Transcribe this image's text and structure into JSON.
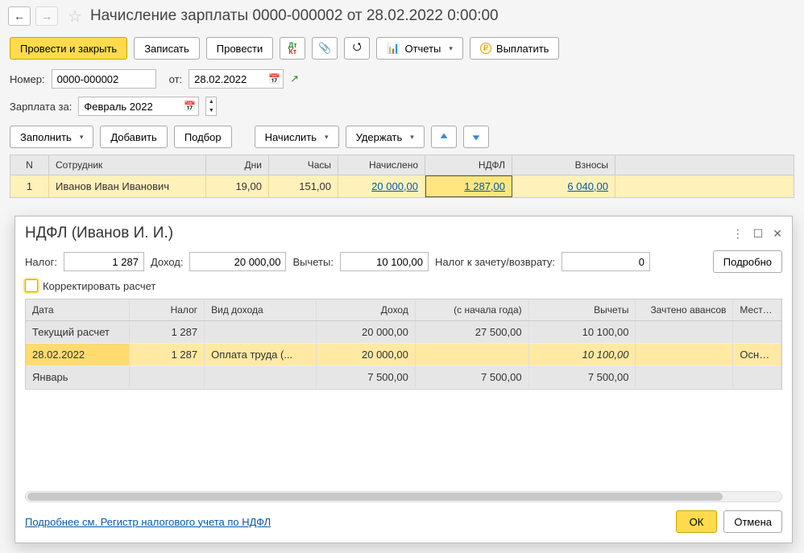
{
  "header": {
    "title": "Начисление зарплаты 0000-000002 от 28.02.2022 0:00:00"
  },
  "toolbar": {
    "post_close": "Провести и закрыть",
    "save": "Записать",
    "post": "Провести",
    "reports": "Отчеты",
    "pay": "Выплатить"
  },
  "form": {
    "number_label": "Номер:",
    "number": "0000-000002",
    "from_label": "от:",
    "date": "28.02.2022",
    "period_label": "Зарплата за:",
    "period": "Февраль 2022"
  },
  "actions": {
    "fill": "Заполнить",
    "add": "Добавить",
    "pick": "Подбор",
    "accrue": "Начислить",
    "withhold": "Удержать"
  },
  "main_table": {
    "cols": {
      "n": "N",
      "emp": "Сотрудник",
      "days": "Дни",
      "hours": "Часы",
      "accrued": "Начислено",
      "tax": "НДФЛ",
      "contrib": "Взносы"
    },
    "row": {
      "n": "1",
      "emp": "Иванов Иван Иванович",
      "days": "19,00",
      "hours": "151,00",
      "accrued": "20 000,00",
      "tax": "1 287,00",
      "contrib": "6 040,00"
    }
  },
  "dialog": {
    "title": "НДФЛ (Иванов И. И.)",
    "tax_label": "Налог:",
    "tax": "1 287",
    "income_label": "Доход:",
    "income": "20 000,00",
    "ded_label": "Вычеты:",
    "ded": "10 100,00",
    "credit_label": "Налог к зачету/возврату:",
    "credit": "0",
    "detail_btn": "Подробно",
    "adjust_label": "Корректировать расчет",
    "cols": {
      "date": "Дата",
      "tax": "Налог",
      "kind": "Вид дохода",
      "income": "Доход",
      "ytd": "(с начала года)",
      "ded": "Вычеты",
      "adv": "Зачтено авансов",
      "place": "Место получения дохода"
    },
    "rows": [
      {
        "date": "Текущий расчет",
        "tax": "1 287",
        "kind": "",
        "income": "20 000,00",
        "ytd": "27 500,00",
        "ded": "10 100,00",
        "adv": "",
        "place": "",
        "cls": "group"
      },
      {
        "date": "28.02.2022",
        "tax": "1 287",
        "kind": "Оплата труда (...",
        "income": "20 000,00",
        "ytd": "",
        "ded": "10 100,00",
        "adv": "",
        "place": "Основное",
        "cls": "sel",
        "ded_italic": true
      },
      {
        "date": "Январь",
        "tax": "",
        "kind": "",
        "income": "7 500,00",
        "ytd": "7 500,00",
        "ded": "7 500,00",
        "adv": "",
        "place": "",
        "cls": "group"
      }
    ],
    "reg_link": "Подробнее см. Регистр налогового учета по НДФЛ",
    "ok": "ОК",
    "cancel": "Отмена"
  }
}
